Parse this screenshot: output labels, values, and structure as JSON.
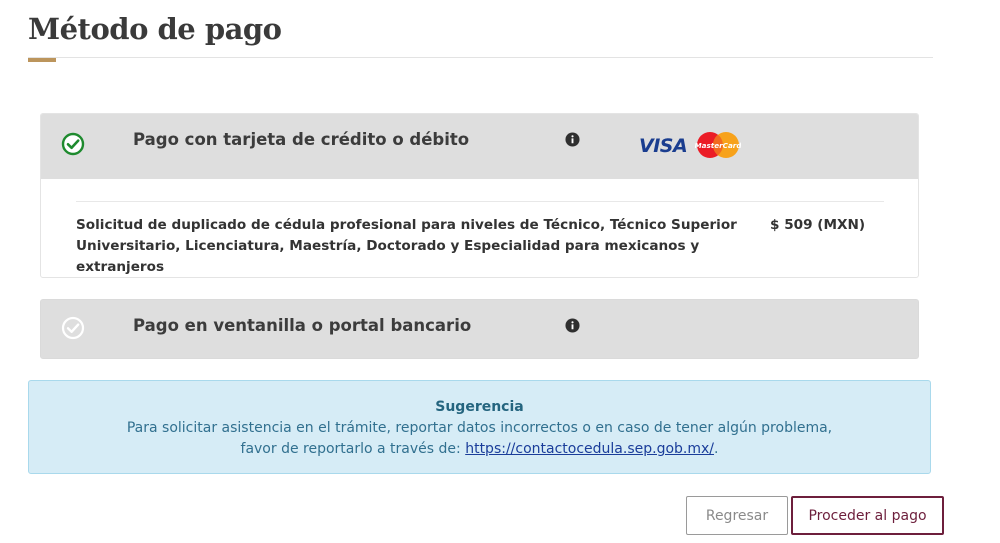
{
  "page": {
    "title": "Método de pago"
  },
  "payment_options": [
    {
      "label": "Pago con tarjeta de crédito o débito",
      "selected": true,
      "brands": [
        "VISA",
        "MasterCard"
      ],
      "service": {
        "description": "Solicitud de duplicado de cédula profesional para niveles de Técnico, Técnico Superior Universitario, Licenciatura, Maestría, Doctorado y Especialidad para mexicanos y extranjeros",
        "price": "$ 509 (MXN)"
      }
    },
    {
      "label": "Pago en ventanilla o portal bancario",
      "selected": false
    }
  ],
  "suggestion": {
    "title": "Sugerencia",
    "line1": "Para solicitar asistencia en el trámite, reportar datos incorrectos o en caso de tener algún problema,",
    "line2_prefix": "favor de reportarlo a través de: ",
    "link_text": "https://contactocedula.sep.gob.mx/",
    "line2_suffix": "."
  },
  "buttons": {
    "back_label": "Regresar",
    "proceed_label": "Proceder al pago"
  },
  "colors": {
    "accent_gold": "#bc955c",
    "check_green": "#1e8a2e",
    "primary_burgundy": "#6d1f3c",
    "info_bg": "#d6ecf6",
    "info_text": "#31708f"
  }
}
